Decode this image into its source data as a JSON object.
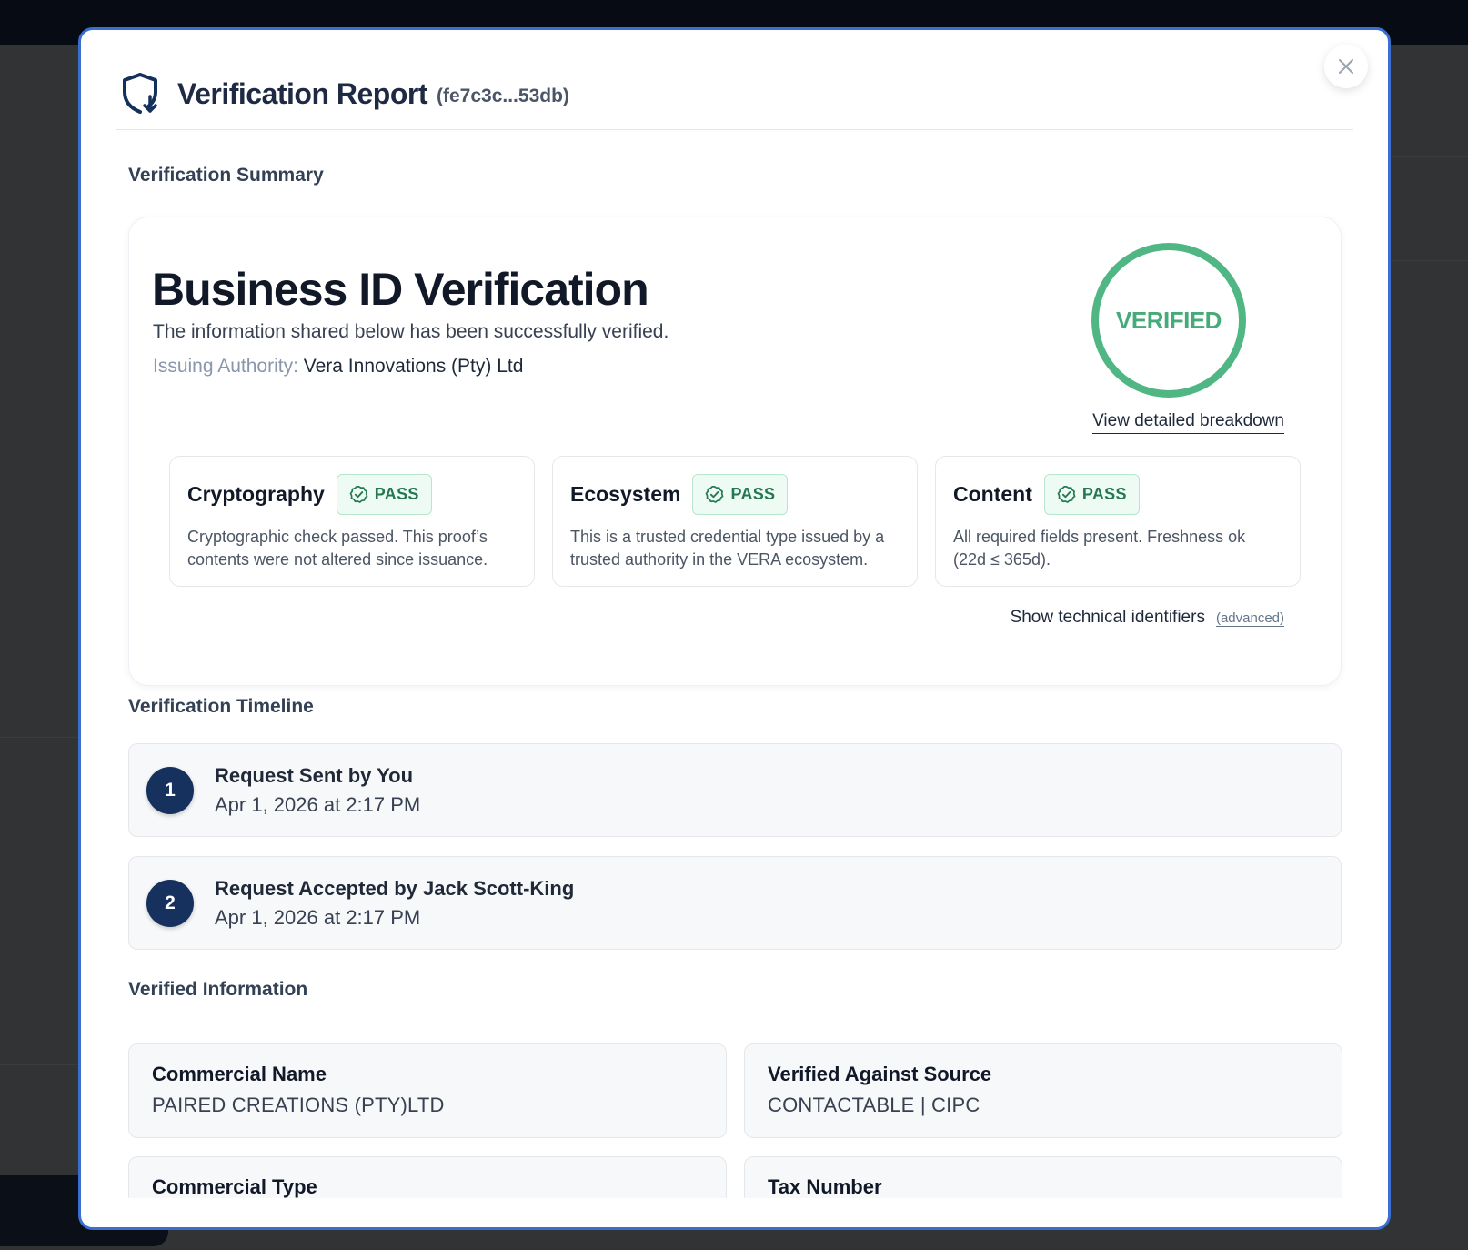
{
  "modal": {
    "title": "Verification Report",
    "report_id": "(fe7c3c...53db)",
    "close_icon": "close-icon",
    "header_icon": "shield-download-icon"
  },
  "summary": {
    "section_label": "Verification Summary",
    "title": "Business ID Verification",
    "subtitle": "The information shared below has been successfully verified.",
    "authority_label": "Issuing Authority:",
    "authority_value": "Vera Innovations (Pty) Ltd",
    "status": "VERIFIED",
    "breakdown_link": "View detailed breakdown",
    "technical_link": "Show technical identifiers",
    "technical_note": "(advanced)",
    "checks": [
      {
        "name": "Cryptography",
        "status": "PASS",
        "description": "Cryptographic check passed. This proof’s contents were not altered since issuance."
      },
      {
        "name": "Ecosystem",
        "status": "PASS",
        "description": "This is a trusted credential type issued by a trusted authority in the VERA ecosystem."
      },
      {
        "name": "Content",
        "status": "PASS",
        "description": "All required fields present. Freshness ok (22d ≤ 365d)."
      }
    ]
  },
  "timeline": {
    "section_label": "Verification Timeline",
    "items": [
      {
        "step": "1",
        "title": "Request Sent by You",
        "time": "Apr 1, 2026 at 2:17 PM"
      },
      {
        "step": "2",
        "title": "Request Accepted by Jack Scott-King",
        "time": "Apr 1, 2026 at 2:17 PM"
      }
    ]
  },
  "verified_info": {
    "section_label": "Verified Information",
    "fields": [
      {
        "label": "Commercial Name",
        "value": "PAIRED CREATIONS (PTY)LTD"
      },
      {
        "label": "Verified Against Source",
        "value": "CONTACTABLE | CIPC"
      },
      {
        "label": "Commercial Type",
        "value": ""
      },
      {
        "label": "Tax Number",
        "value": ""
      }
    ]
  },
  "colors": {
    "modal_border": "#3a6fd1",
    "verified_green": "#4fb684",
    "pass_green": "#23784f",
    "step_navy": "#16315e"
  }
}
